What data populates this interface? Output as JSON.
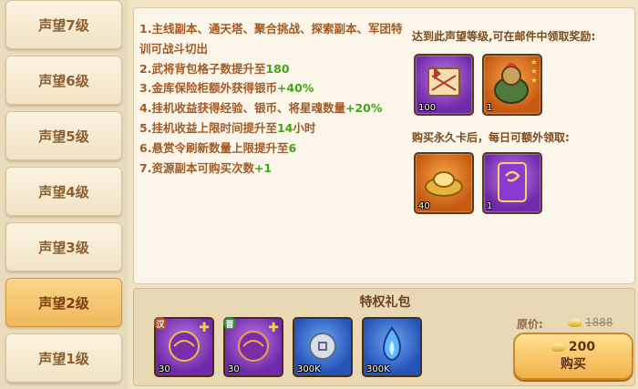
{
  "sidebar": {
    "tabs": [
      {
        "label": "声望7级",
        "active": false
      },
      {
        "label": "声望6级",
        "active": false
      },
      {
        "label": "声望5级",
        "active": false
      },
      {
        "label": "声望4级",
        "active": false
      },
      {
        "label": "声望3级",
        "active": false
      },
      {
        "label": "声望2级",
        "active": true
      },
      {
        "label": "声望1级",
        "active": false
      }
    ]
  },
  "perks": [
    {
      "text": "1.主线副本、通天塔、聚合挑战、探索副本、军团特训可战斗切出",
      "highlight": ""
    },
    {
      "text": "2.武将背包格子数提升至",
      "highlight": "180"
    },
    {
      "text": "3.金库保险柜额外获得银币",
      "highlight": "+40%"
    },
    {
      "text": "4.挂机收益获得经验、银币、将星魂数量",
      "highlight": "+20%"
    },
    {
      "text": "5.挂机收益上限时间提升至",
      "highlight": "14",
      "suffix": "小时"
    },
    {
      "text": "6.悬赏令刷新数量上限提升至",
      "highlight": "6"
    },
    {
      "text": "7.资源副本可购买次数",
      "highlight": "+1"
    }
  ],
  "reach_rewards": {
    "title": "达到此声望等级,可在邮件中领取奖励:",
    "items": [
      {
        "name": "scroll-map",
        "count": "100",
        "color": "purple"
      },
      {
        "name": "armored-creature",
        "count": "1",
        "color": "orange"
      }
    ]
  },
  "daily_rewards": {
    "title": "购买永久卡后，每日可额外领取:",
    "items": [
      {
        "name": "gold-ingot",
        "count": "40",
        "color": "orange"
      },
      {
        "name": "purple-card",
        "count": "1",
        "color": "purple"
      }
    ]
  },
  "gift": {
    "title": "特权礼包",
    "items": [
      {
        "name": "dragon-mask-purple",
        "count": "30",
        "badge": "汉"
      },
      {
        "name": "dragon-mask-gold",
        "count": "30",
        "badge": "晋"
      },
      {
        "name": "silver-coin",
        "count": "300K",
        "badge": ""
      },
      {
        "name": "blue-flame",
        "count": "300K",
        "badge": ""
      }
    ],
    "price_label": "原价:",
    "price_old": "1888",
    "price": "200",
    "buy_label": "购买"
  }
}
